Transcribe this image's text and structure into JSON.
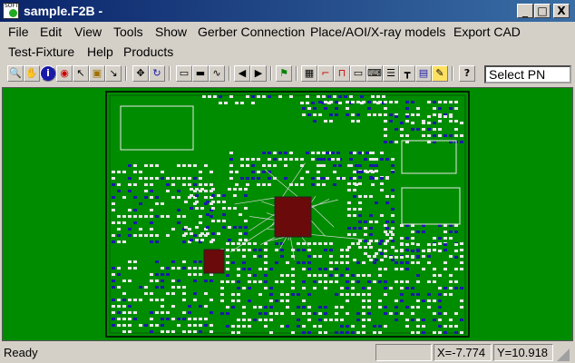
{
  "window": {
    "title": "sample.F2B -",
    "app_icon_text": "SOFT",
    "min_label": "_",
    "max_label": "□",
    "close_label": "X"
  },
  "menu": [
    {
      "label": "File"
    },
    {
      "label": "Edit"
    },
    {
      "label": "View"
    },
    {
      "label": "Tools"
    },
    {
      "label": "Show"
    },
    {
      "label": "Gerber Connection"
    },
    {
      "label": "Place/AOI/X-ray models"
    },
    {
      "label": "Export CAD"
    },
    {
      "label": "Test-Fixture"
    },
    {
      "label": "Help"
    },
    {
      "label": "Products"
    }
  ],
  "toolbar": {
    "select_pn_value": "Select PN",
    "buttons": [
      {
        "icon": "zoom-icon",
        "glyph": "🔍"
      },
      {
        "icon": "pan-hand-icon",
        "glyph": "✋"
      },
      {
        "icon": "info-icon",
        "glyph": "i"
      },
      {
        "icon": "target-icon",
        "glyph": "◉"
      },
      {
        "icon": "select-arrow-icon",
        "glyph": "↖"
      },
      {
        "icon": "select-part-icon",
        "glyph": "▣"
      },
      {
        "icon": "select-pin-icon",
        "glyph": "↘"
      },
      {
        "icon": "move-icon",
        "glyph": "✥"
      },
      {
        "icon": "rotate-icon",
        "glyph": "↻"
      },
      {
        "icon": "component-top-icon",
        "glyph": "▭"
      },
      {
        "icon": "component-bottom-icon",
        "glyph": "▬"
      },
      {
        "icon": "waveform-icon",
        "glyph": "∿"
      },
      {
        "icon": "prev-icon",
        "glyph": "◀"
      },
      {
        "icon": "next-icon",
        "glyph": "▶"
      },
      {
        "icon": "flag-icon",
        "glyph": "⚑"
      },
      {
        "icon": "chip-icon",
        "glyph": "▦"
      },
      {
        "icon": "net-icon",
        "glyph": "⌐"
      },
      {
        "icon": "pad-icon",
        "glyph": "⊓"
      },
      {
        "icon": "connector-icon",
        "glyph": "▭"
      },
      {
        "icon": "keyboard-icon",
        "glyph": "⌨"
      },
      {
        "icon": "list-icon",
        "glyph": "☰"
      },
      {
        "icon": "probe-icon",
        "glyph": "┳"
      },
      {
        "icon": "text-box-icon",
        "glyph": "▤"
      },
      {
        "icon": "note-icon",
        "glyph": "✎"
      },
      {
        "icon": "help-pointer-icon",
        "glyph": "?"
      }
    ]
  },
  "status": {
    "ready": "Ready",
    "x_coord": "X=-7.774",
    "y_coord": "Y=10.918"
  },
  "colors": {
    "board_background": "#008c00",
    "board_outline": "#000000",
    "pad_white": "#e8e8e8",
    "pad_blue": "#1a1aa8",
    "bga_red": "#7a1010"
  }
}
